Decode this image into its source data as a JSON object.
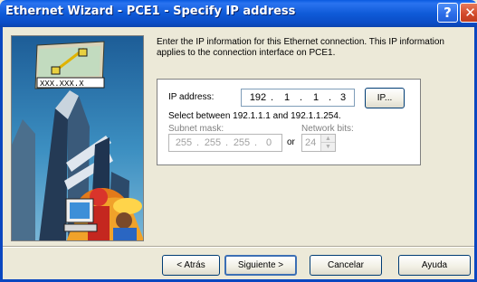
{
  "window": {
    "title": "Ethernet Wizard - PCE1 - Specify IP address",
    "help_glyph": "?",
    "close_glyph": "✕"
  },
  "picture": {
    "address_text": "XXX.XXX.X"
  },
  "intro_text": "Enter the IP information for this Ethernet connection. This IP information applies to the connection interface on PCE1.",
  "ip": {
    "label": "IP address:",
    "octets": [
      "192",
      "1",
      "1",
      "3"
    ],
    "button_label": "IP...",
    "range_text": "Select between 192.1.1.1 and 192.1.1.254."
  },
  "mask": {
    "label": "Subnet mask:",
    "octets": [
      "255",
      "255",
      "255",
      "0"
    ],
    "or_text": "or"
  },
  "network_bits": {
    "label": "Network bits:",
    "value": "24"
  },
  "buttons": {
    "back": "< Atrás",
    "next": "Siguiente >",
    "cancel": "Cancelar",
    "help": "Ayuda"
  }
}
